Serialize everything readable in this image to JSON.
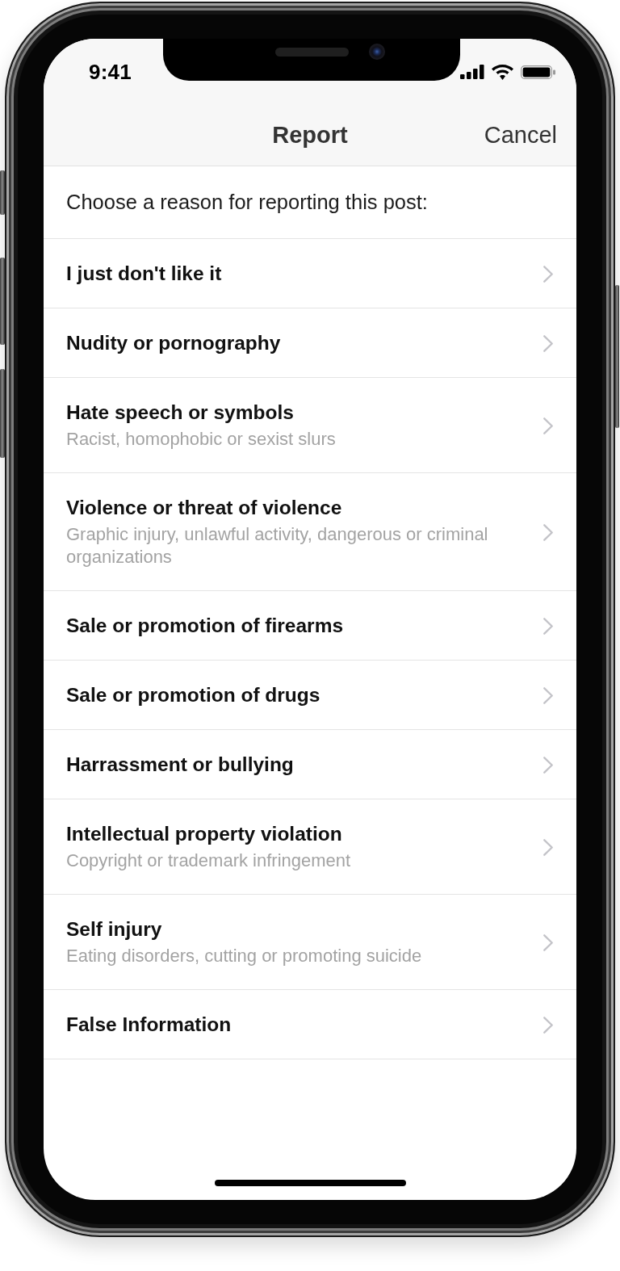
{
  "status_bar": {
    "time": "9:41"
  },
  "nav_bar": {
    "title": "Report",
    "cancel_button": "Cancel"
  },
  "prompt": "Choose a reason for reporting this post:",
  "reasons": [
    {
      "title": "I just don't like it"
    },
    {
      "title": "Nudity or pornography"
    },
    {
      "title": "Hate speech or symbols",
      "subtitle": "Racist, homophobic or sexist slurs"
    },
    {
      "title": "Violence or threat of violence",
      "subtitle": "Graphic injury, unlawful activity, dangerous or criminal organizations"
    },
    {
      "title": "Sale or promotion of firearms"
    },
    {
      "title": "Sale or promotion of drugs"
    },
    {
      "title": "Harrassment or bullying"
    },
    {
      "title": "Intellectual property violation",
      "subtitle": "Copyright or trademark infringement"
    },
    {
      "title": "Self injury",
      "subtitle": "Eating disorders, cutting or promoting suicide"
    },
    {
      "title": "False Information"
    }
  ]
}
